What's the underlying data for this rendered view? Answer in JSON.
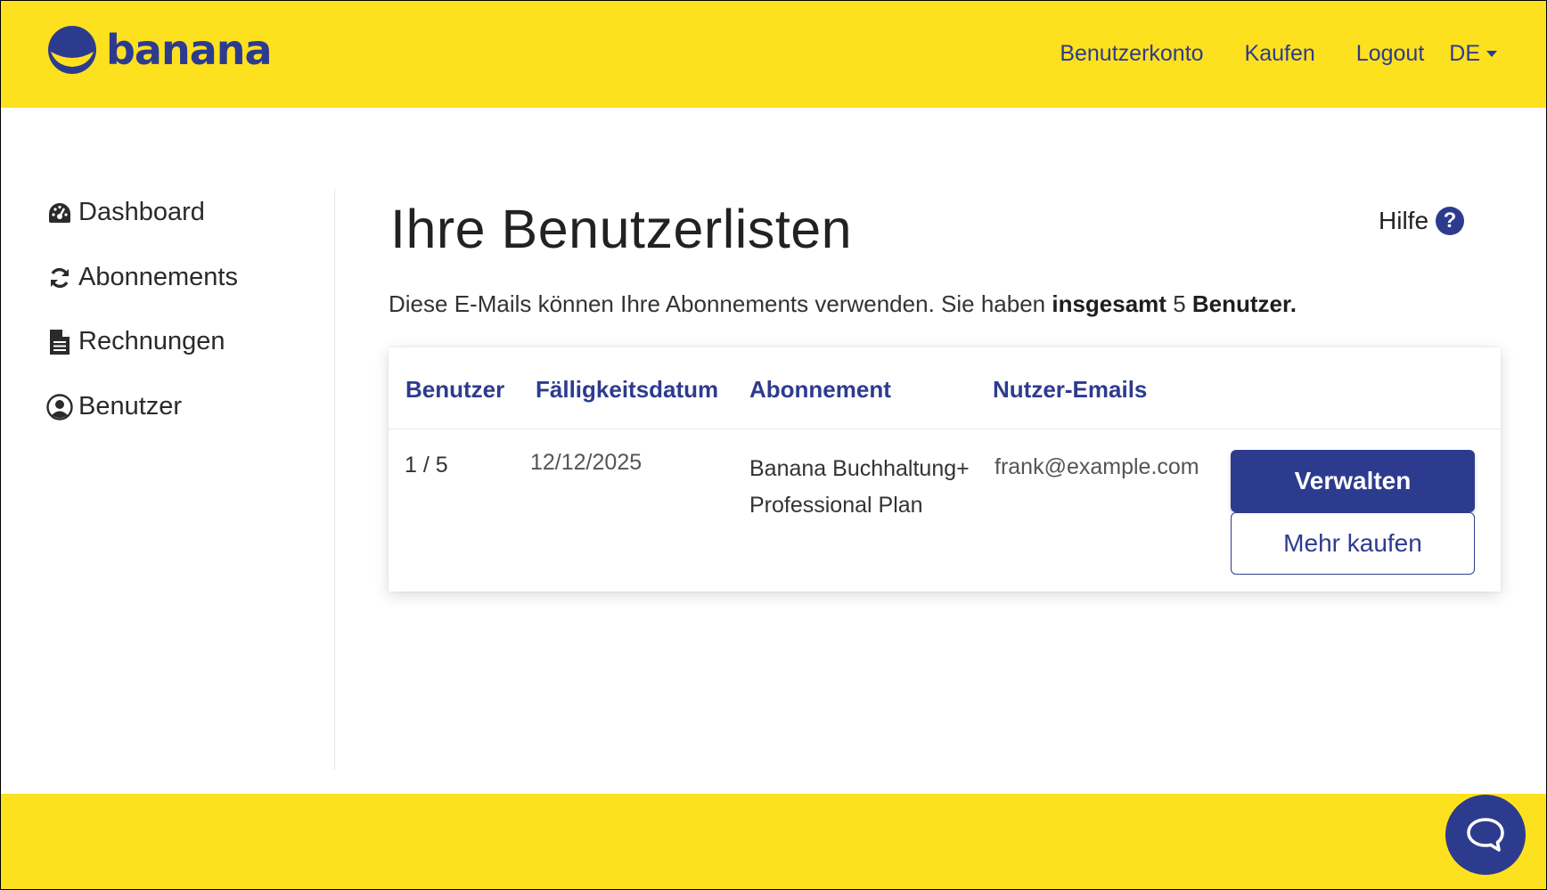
{
  "header": {
    "logo_text": "banana",
    "nav": {
      "account": "Benutzerkonto",
      "buy": "Kaufen",
      "logout": "Logout",
      "language": "DE"
    }
  },
  "sidebar": {
    "items": [
      {
        "label": "Dashboard",
        "icon": "dashboard-icon"
      },
      {
        "label": "Abonnements",
        "icon": "sync-icon"
      },
      {
        "label": "Rechnungen",
        "icon": "invoice-file-icon"
      },
      {
        "label": "Benutzer",
        "icon": "user-circle-icon"
      }
    ]
  },
  "main": {
    "title": "Ihre Benutzerlisten",
    "help_label": "Hilfe",
    "help_icon": "?",
    "description_prefix": "Diese E-Mails können Ihre Abonnements verwenden. Sie haben ",
    "description_bold_1": "insgesamt",
    "description_count": "5",
    "description_bold_2": "Benutzer."
  },
  "table": {
    "headers": [
      "Benutzer",
      "Fälligkeitsdatum",
      "Abonnement",
      "Nutzer-Emails"
    ],
    "rows": [
      {
        "users": "1 / 5",
        "due_date": "12/12/2025",
        "subscription_line1": "Banana Buchhaltung+",
        "subscription_line2": "Professional Plan",
        "email": "frank@example.com",
        "manage_label": "Verwalten",
        "buy_more_label": "Mehr kaufen"
      }
    ]
  },
  "colors": {
    "brand_yellow": "#fee11e",
    "brand_blue": "#2d3b8f"
  }
}
